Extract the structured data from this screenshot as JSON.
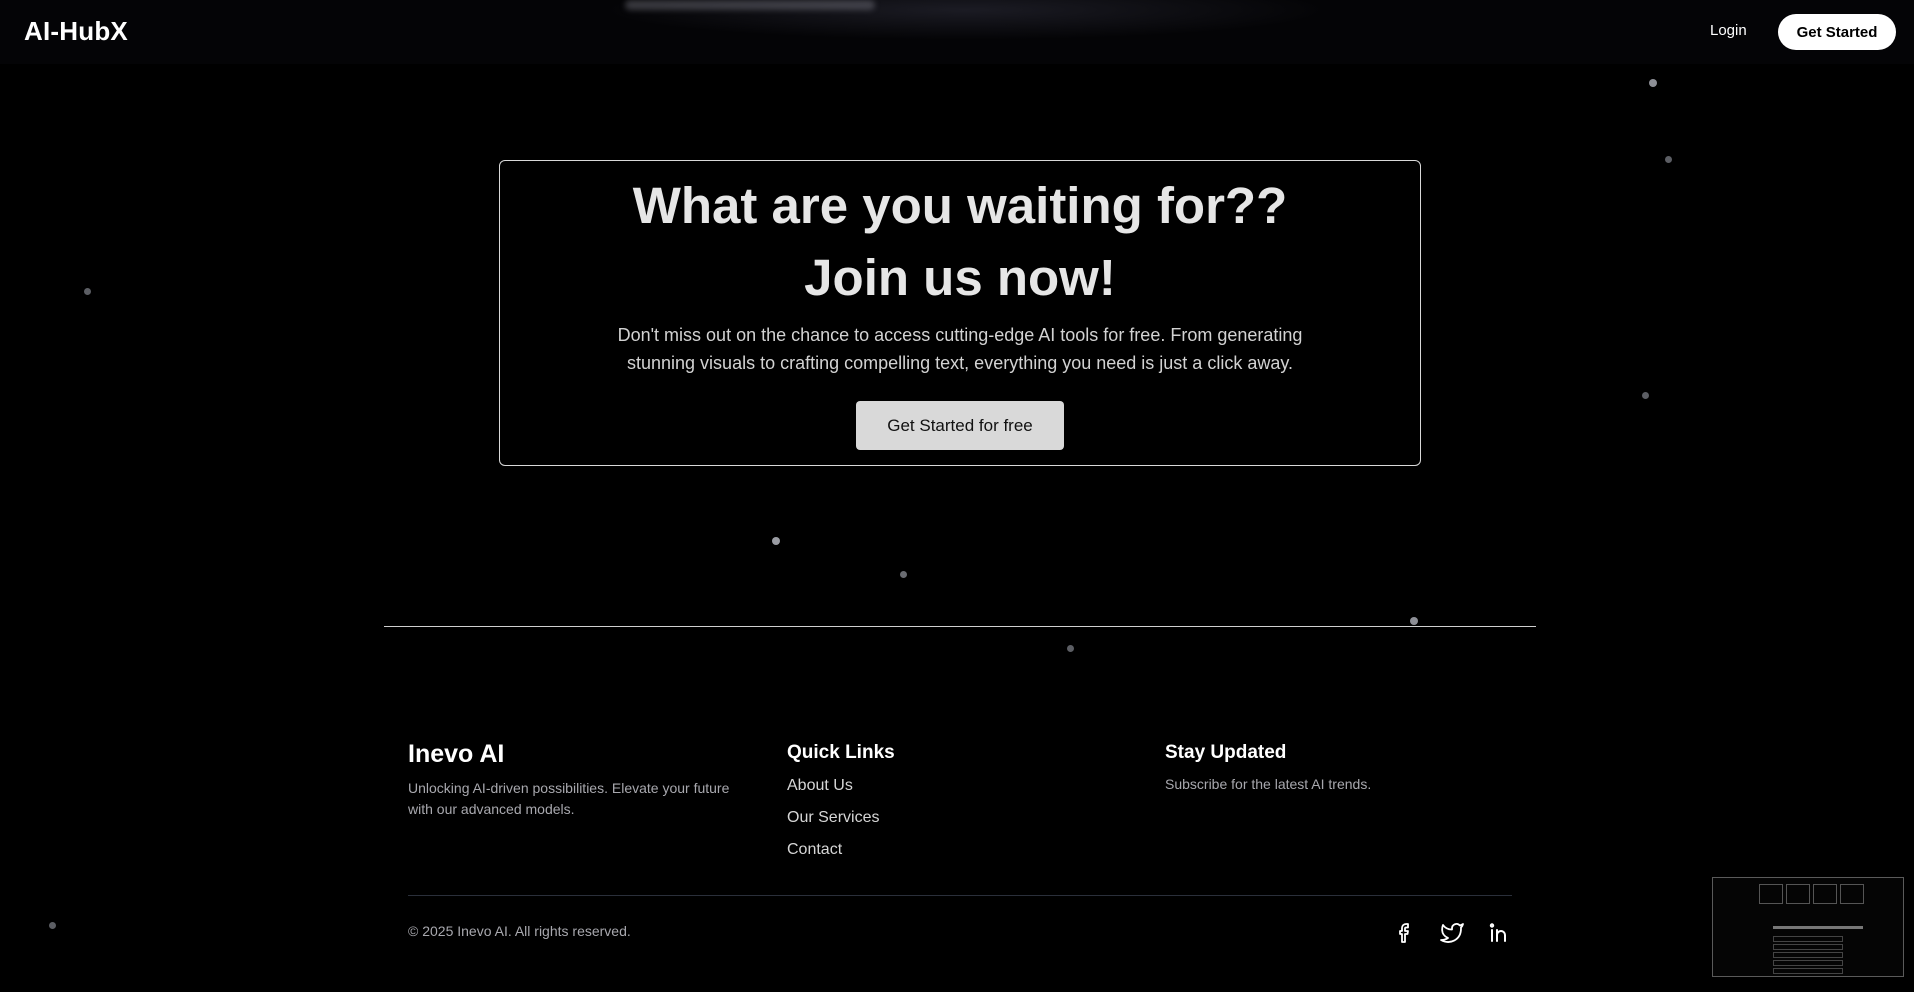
{
  "header": {
    "logo": "AI-HubX",
    "login_label": "Login",
    "get_started_label": "Get Started"
  },
  "cta": {
    "heading_1": "What are you waiting for??",
    "heading_2": "Join us now!",
    "description": "Don't miss out on the chance to access cutting-edge AI tools for free. From generating stunning visuals to crafting compelling text, everything you need is just a click away.",
    "button_label": "Get Started for free"
  },
  "footer": {
    "brand": "Inevo AI",
    "brand_description": "Unlocking AI-driven possibilities. Elevate your future with our advanced models.",
    "quick_links_heading": "Quick Links",
    "quick_links": [
      "About Us",
      "Our Services",
      "Contact"
    ],
    "stay_updated_heading": "Stay Updated",
    "stay_updated_text": "Subscribe for the latest AI trends.",
    "copyright": "© 2025 Inevo AI. All rights reserved.",
    "social_icons": [
      "facebook-icon",
      "twitter-icon",
      "linkedin-icon"
    ]
  },
  "colors": {
    "background": "#000000",
    "cta_button": "#d9d9d9",
    "muted_text": "#a8a8ae"
  }
}
